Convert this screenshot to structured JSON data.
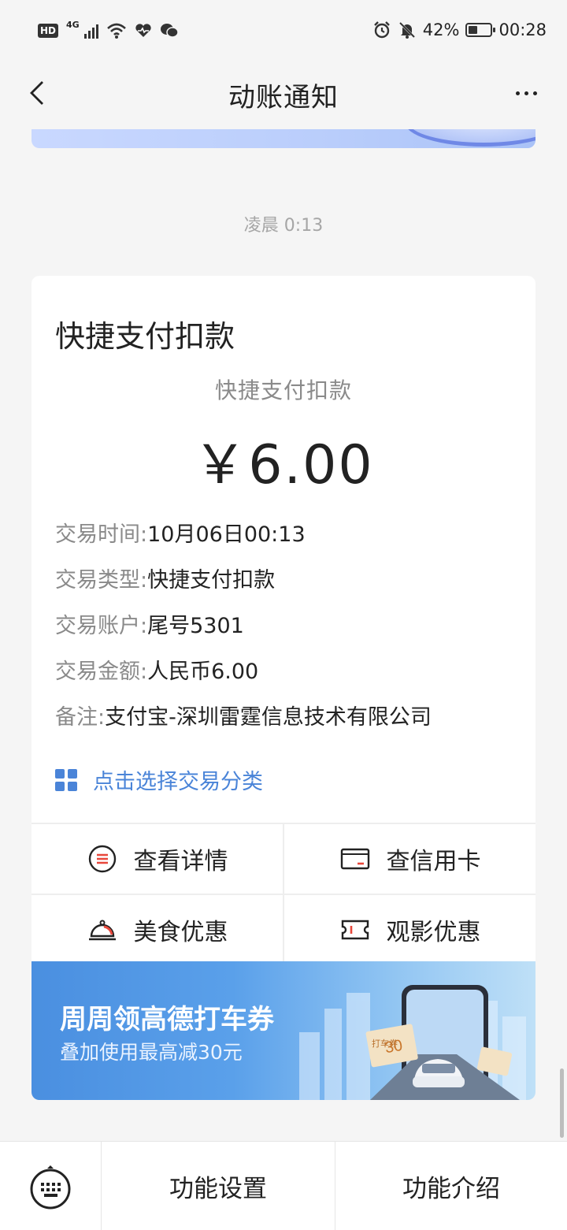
{
  "status_bar": {
    "hd_label": "HD",
    "network": "4G",
    "battery_percent": "42%",
    "time": "00:28",
    "battery_level": 0.42
  },
  "nav": {
    "title": "动账通知"
  },
  "timestamp": "凌晨 0:13",
  "card": {
    "title": "快捷支付扣款",
    "subtitle": "快捷支付扣款",
    "amount": "￥6.00",
    "details": [
      {
        "label": "交易时间:",
        "value": "10月06日00:13"
      },
      {
        "label": "交易类型:",
        "value": "快捷支付扣款"
      },
      {
        "label": "交易账户:",
        "value": "尾号5301"
      },
      {
        "label": "交易金额:",
        "value": "人民币6.00"
      },
      {
        "label": "备注:",
        "value": "支付宝-深圳雷霆信息技术有限公司"
      }
    ],
    "category_link": "点击选择交易分类",
    "actions": {
      "view_details": "查看详情",
      "check_card": "查信用卡",
      "food_deals": "美食优惠",
      "movie_deals": "观影优惠"
    },
    "ad": {
      "title": "周周领高德打车券",
      "subtitle": "叠加使用最高减30元",
      "ticket_text": "打车券",
      "ticket_value": "30"
    }
  },
  "bottom_bar": {
    "settings": "功能设置",
    "intro": "功能介绍"
  },
  "colors": {
    "accent": "#4a84d8",
    "ad_blue": "#4a8fe0",
    "bell_red": "#e8473b"
  }
}
